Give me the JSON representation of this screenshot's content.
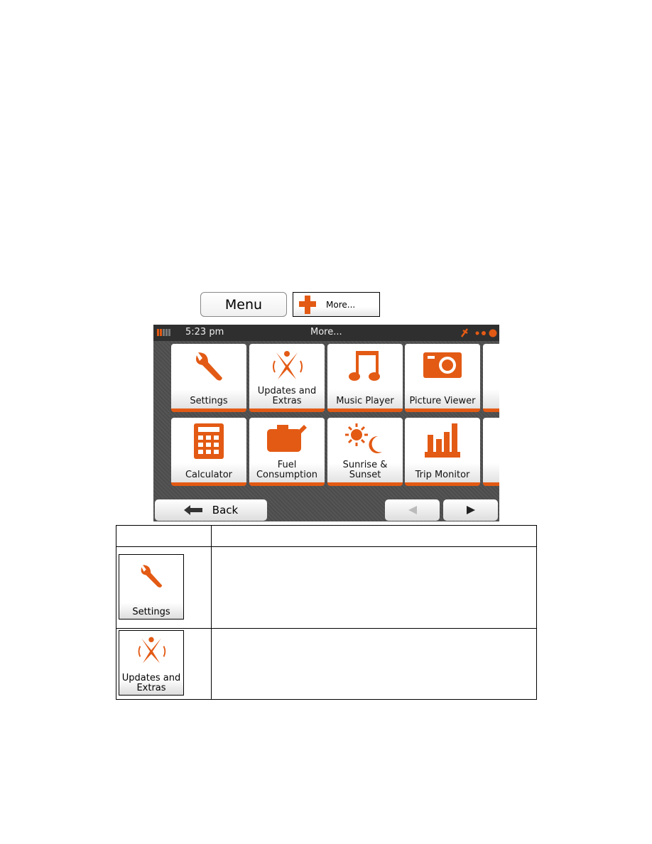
{
  "buttons": {
    "menu": "Menu",
    "more": "More..."
  },
  "device": {
    "status": {
      "time": "5:23 pm",
      "title": "More..."
    },
    "tiles": [
      {
        "label": "Settings",
        "icon": "wrench-icon"
      },
      {
        "label": "Updates and Extras",
        "icon": "updates-icon"
      },
      {
        "label": "Music Player",
        "icon": "music-note-icon"
      },
      {
        "label": "Picture Viewer",
        "icon": "camera-icon"
      },
      {
        "label": "Calculator",
        "icon": "calculator-icon"
      },
      {
        "label": "Fuel Consumption",
        "icon": "fuel-can-icon"
      },
      {
        "label": "Sunrise & Sunset",
        "icon": "sun-moon-icon"
      },
      {
        "label": "Trip Monitor",
        "icon": "bar-chart-icon"
      }
    ],
    "back": "Back"
  },
  "table": {
    "rows": [
      {
        "label": "Settings"
      },
      {
        "label": "Updates and Extras"
      }
    ]
  },
  "colors": {
    "accent": "#e35a14",
    "screen_bg": "#4f4f4f"
  }
}
